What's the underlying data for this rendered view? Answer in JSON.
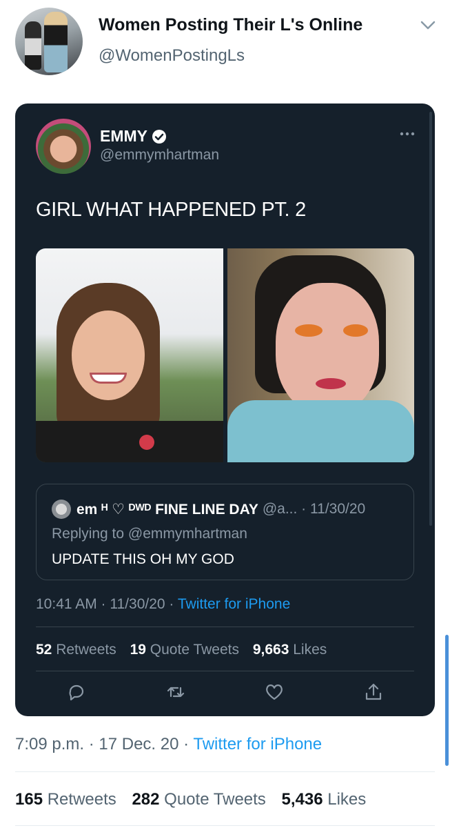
{
  "outer": {
    "author_name": "Women Posting Their L's Online",
    "author_handle": "@WomenPostingLs",
    "timestamp": "7:09 p.m. · 17 Dec. 20 · ",
    "source": "Twitter for iPhone",
    "stats": [
      {
        "count": "165",
        "label": "Retweets"
      },
      {
        "count": "282",
        "label": "Quote Tweets"
      },
      {
        "count": "5,436",
        "label": "Likes"
      }
    ],
    "icons": {
      "menu": "chevron-down-icon"
    }
  },
  "inner": {
    "author_name": "EMMY",
    "author_handle": "@emmymhartman",
    "text": "GIRL WHAT HAPPENED PT. 2",
    "timestamp": "10:41 AM · 11/30/20 · ",
    "source": "Twitter for iPhone",
    "stats": [
      {
        "count": "52",
        "label": "Retweets"
      },
      {
        "count": "19",
        "label": "Quote Tweets"
      },
      {
        "count": "9,663",
        "label": "Likes"
      }
    ],
    "quote": {
      "author_name": "em ᴴ ♡ ᴰᵂᴰ FINE LINE DAY",
      "meta": "@a... · 11/30/20",
      "reply_prefix": "Replying to ",
      "reply_mention": "@emmymhartman",
      "text": "UPDATE THIS OH MY GOD"
    },
    "icons": {
      "verified": "verified-badge-icon",
      "more": "more-options-icon",
      "reply": "reply-icon",
      "retweet": "retweet-icon",
      "like": "like-heart-icon",
      "share": "share-icon"
    }
  },
  "colors": {
    "card_background": "#15202b",
    "link": "#1d9bf0",
    "secondary_text": "#8b98a5"
  }
}
